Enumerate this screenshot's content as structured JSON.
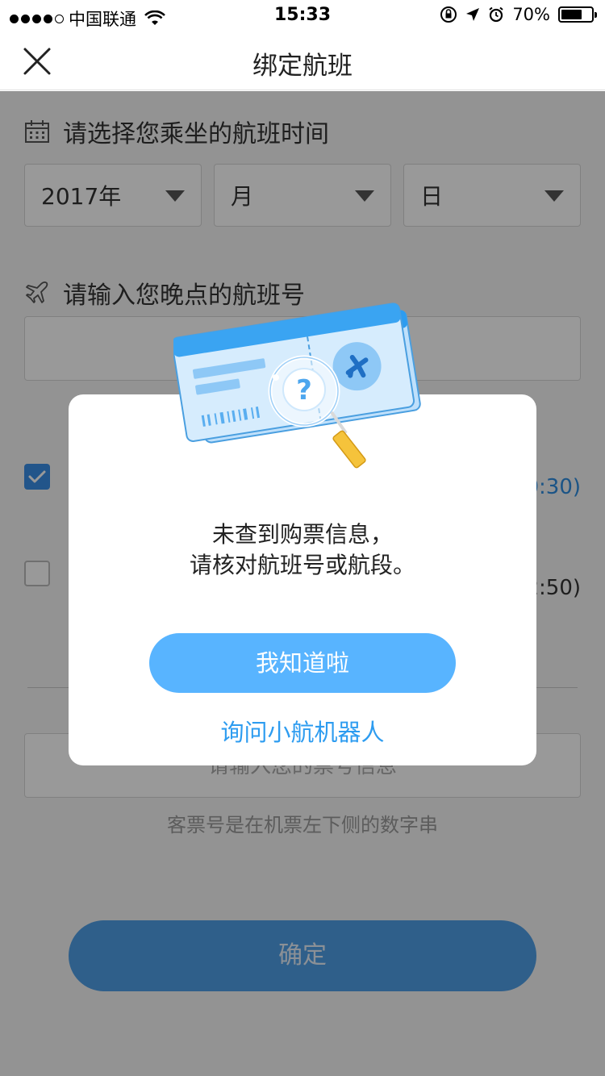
{
  "status_bar": {
    "carrier": "中国联通",
    "time": "15:33",
    "battery": "70%",
    "battery_level": 0.7
  },
  "nav": {
    "title": "绑定航班",
    "close_icon": "close-icon"
  },
  "form": {
    "date_label": "请选择您乘坐的航班时间",
    "year": "2017年",
    "month": "月",
    "day": "日",
    "flight_label": "请输入您晚点的航班号",
    "flight_value": "",
    "option_1_time": "0:30)",
    "option_2_time": "2:50)",
    "ticket_placeholder": "请输入您的票号信息",
    "ticket_hint": "客票号是在机票左下侧的数字串",
    "confirm": "确定"
  },
  "dialog": {
    "message_line1": "未查到购票信息，",
    "message_line2": "请核对航班号或航段。",
    "primary_button": "我知道啦",
    "link": "询问小航机器人"
  },
  "colors": {
    "primary": "#58b4ff",
    "link": "#2d9cf0",
    "overlay": "rgba(0,0,0,0.4)"
  }
}
